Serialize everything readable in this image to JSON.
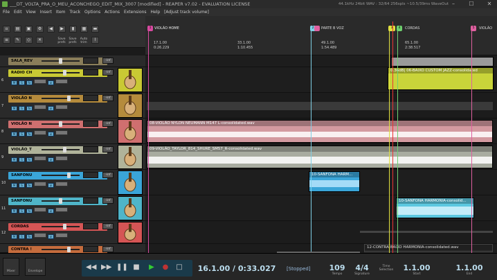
{
  "window": {
    "title": "___DT_VOLTA_PRA_O_MEU_ACONCHEGO_EDIT_MIX_3007 [modified] - REAPER v7.02 - EVALUATION LICENSE",
    "perf": "44.1kHz 24bit WAV : 32/64 256spls ~10.5/39ms WaveOut"
  },
  "menu": [
    "File",
    "Edit",
    "View",
    "Insert",
    "Item",
    "Track",
    "Options",
    "Actions",
    "Extensions",
    "Help",
    "[Adjust track volume]"
  ],
  "toolbar": {
    "labels": [
      "Save",
      "Save",
      "Auto"
    ],
    "sublabels": [
      "prefs",
      "prefs",
      "trim"
    ]
  },
  "tracks": [
    {
      "num": "",
      "name": "SALA_REV",
      "color": "#8a7e5a",
      "db": "-inf"
    },
    {
      "num": "6",
      "name": "RADIO CH",
      "color": "#c9c934",
      "db": "-inf"
    },
    {
      "num": "7",
      "name": "VIOLÃO N",
      "color": "#b58b3c",
      "db": "-inf"
    },
    {
      "num": "8",
      "name": "VIOLÃO N",
      "color": "#cf6f6f",
      "db": "-inf"
    },
    {
      "num": "9",
      "name": "VIOLÃO_T",
      "color": "#b0b39a",
      "db": "-inf"
    },
    {
      "num": "10",
      "name": "SANFONU",
      "color": "#3aa5d8",
      "db": "-inf"
    },
    {
      "num": "11",
      "name": "SANFONU",
      "color": "#4fb5c9",
      "db": "-inf"
    },
    {
      "num": "12",
      "name": "CORDAS",
      "color": "#d55555",
      "db": "-inf"
    },
    {
      "num": "",
      "name": "CONTRA !",
      "color": "#c56c3d",
      "db": "-inf"
    }
  ],
  "regions": [
    {
      "id": "1",
      "name": "VIOLÃO HOME",
      "color": "#d84aa0"
    },
    {
      "id": "2",
      "name": "PARTE B VOZ",
      "color": "#7fd0e6"
    },
    {
      "id": "3",
      "name": "",
      "color": "#e0e040"
    },
    {
      "id": "4",
      "name": "CORDAS",
      "color": "#6fd06f"
    },
    {
      "id": "5",
      "name": "VIOLÃO",
      "color": "#e060a0"
    }
  ],
  "ruler": [
    {
      "bar": "17.1.00",
      "time": "0:26.229"
    },
    {
      "bar": "33.1.00",
      "time": "1:10.455"
    },
    {
      "bar": "49.1.00",
      "time": "1:54.489"
    },
    {
      "bar": "65.1.00",
      "time": "2:38.517"
    }
  ],
  "items": [
    {
      "name": "0.36dB| 06-BAIXO CUSTOM JAZZ-consolidated"
    },
    {
      "name": "08-VIOLÃO NYLON NEUMANN M147 L-consolidated.wav"
    },
    {
      "name": "09-VIOLÃO_TAYLOR_814_SHURE_SM57_R-consolidated.wav"
    },
    {
      "name": "10-SANFONA HARM..."
    },
    {
      "name": "10-SANFONA HARMONIA-consolid..."
    },
    {
      "name": "12-CONTRA BAIXO HARMONIA-consolidated.wav"
    }
  ],
  "transport": {
    "position": "16.1.00 / 0:33.027",
    "status": "[Stopped]",
    "bpm": "109",
    "bpm_label": "Tempo",
    "sig": "4/4",
    "sig_label": "Signature",
    "sel_label": "Time Selection",
    "start": "1.1.00",
    "start_label": "Start",
    "end": "1.1.00",
    "end_label": "End",
    "left_labels": [
      "Mixer",
      "Envelope"
    ]
  }
}
